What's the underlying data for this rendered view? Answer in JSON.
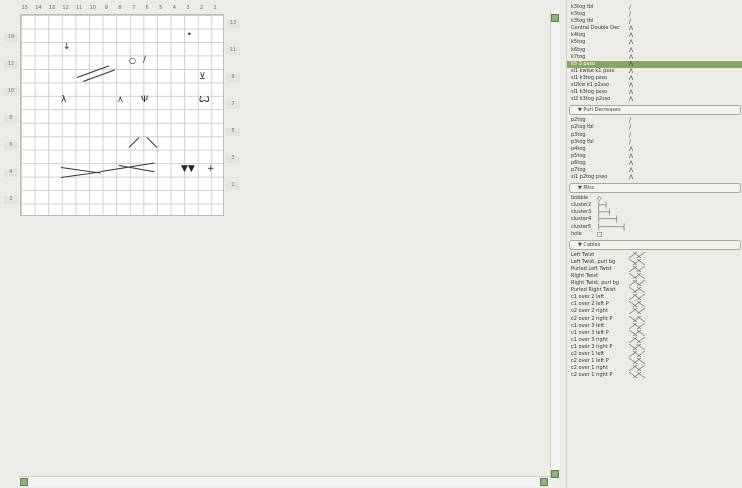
{
  "chart": {
    "columns": [
      "15",
      "14",
      "13",
      "12",
      "11",
      "10",
      "9",
      "8",
      "7",
      "6",
      "5",
      "4",
      "3",
      "2",
      "1"
    ],
    "rows_left": [
      "14",
      "12",
      "10",
      "8",
      "6",
      "4",
      "2"
    ],
    "rows_right": [
      "13",
      "11",
      "9",
      "7",
      "5",
      "3",
      "1"
    ],
    "symbols": [
      "•",
      "↓",
      "○",
      "/",
      "⊻",
      "λ",
      "⋏",
      "Ψ",
      "Ꙍ",
      "▼▼",
      "+"
    ]
  },
  "panel": {
    "top_items": [
      {
        "label": "k3tog tbl",
        "glyph": "/"
      },
      {
        "label": "k3tog",
        "glyph": "/"
      },
      {
        "label": "k3tog tbl",
        "glyph": "/"
      },
      {
        "label": "Central Double Dec",
        "glyph": "Λ"
      },
      {
        "label": "k4tog",
        "glyph": "Λ"
      },
      {
        "label": "k5tog",
        "glyph": "Λ"
      },
      {
        "label": "k6tog",
        "glyph": "Λ"
      },
      {
        "label": "k7tog",
        "glyph": "Λ"
      },
      {
        "label": "k5 3 psso",
        "glyph": "Λ",
        "selected": true
      },
      {
        "label": "sl1 kwise k1 psso",
        "glyph": "Λ"
      },
      {
        "label": "sl1 k3tog psso",
        "glyph": "Λ"
      },
      {
        "label": "sl2kw k1 p2sso",
        "glyph": "Λ"
      },
      {
        "label": "sl1 k3tog psso",
        "glyph": "Λ"
      },
      {
        "label": "sl2 k3tog p2sso",
        "glyph": "Λ"
      }
    ],
    "purl_header": "▼ Purl Decreases",
    "purl_items": [
      {
        "label": "p2tog",
        "glyph": "/"
      },
      {
        "label": "p2tog tbl",
        "glyph": "/"
      },
      {
        "label": "p3tog",
        "glyph": "/"
      },
      {
        "label": "p3tog tbl",
        "glyph": "/"
      },
      {
        "label": "p4tog",
        "glyph": "Λ"
      },
      {
        "label": "p5tog",
        "glyph": "Λ"
      },
      {
        "label": "p6tog",
        "glyph": "Λ"
      },
      {
        "label": "p7tog",
        "glyph": "Λ"
      },
      {
        "label": "sl1 p2tog psso",
        "glyph": "Λ"
      }
    ],
    "misc_header": "▼ Misc",
    "misc_items": [
      {
        "label": "bobble",
        "glyph": "◇"
      },
      {
        "label": "cluster2",
        "glyph": "├─┤"
      },
      {
        "label": "cluster3",
        "glyph": "├──┤"
      },
      {
        "label": "cluster4",
        "glyph": "├────┤"
      },
      {
        "label": "cluster5",
        "glyph": "├──────┤"
      },
      {
        "label": "hole",
        "glyph": "□"
      }
    ],
    "cables_header": "▼ Cables",
    "cable_items": [
      "Left Twist",
      "Left Twist, purl bg",
      "Purled Left Twist",
      "Right Twist",
      "Right Twist, purl bg",
      "Purled Right Twist",
      "c1 over 2 left",
      "c1 over 2 left P",
      "c2 over 2 right",
      "c2 over 2 right P",
      "c1 over 3 left",
      "c1 over 3 left P",
      "c1 over 3 right",
      "c1 over 3 right P",
      "c2 over 1 left",
      "c2 over 1 left P",
      "c2 over 1 right",
      "c2 over 1 right P"
    ]
  }
}
